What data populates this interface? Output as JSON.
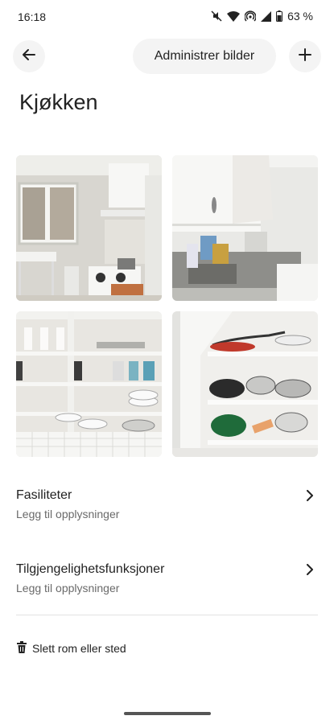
{
  "status": {
    "time": "16:18",
    "battery": "63 %",
    "icons": [
      "mute-icon",
      "wifi-icon",
      "hotspot-icon",
      "signal-icon",
      "battery-icon"
    ]
  },
  "header": {
    "back_icon": "arrow-left-icon",
    "manage_label": "Administrer bilder",
    "add_icon": "plus-icon"
  },
  "room": {
    "title": "Kjøkken"
  },
  "photos": [
    {
      "description_icon": "kitchen-photo"
    },
    {
      "description_icon": "sink-photo"
    },
    {
      "description_icon": "shelves-photo"
    },
    {
      "description_icon": "pots-photo"
    }
  ],
  "rows": [
    {
      "title": "Fasiliteter",
      "subtitle": "Legg til opplysninger"
    },
    {
      "title": "Tilgjengelighetsfunksjoner",
      "subtitle": "Legg til opplysninger"
    }
  ],
  "delete": {
    "label": "Slett rom eller sted",
    "icon": "trash-icon"
  }
}
